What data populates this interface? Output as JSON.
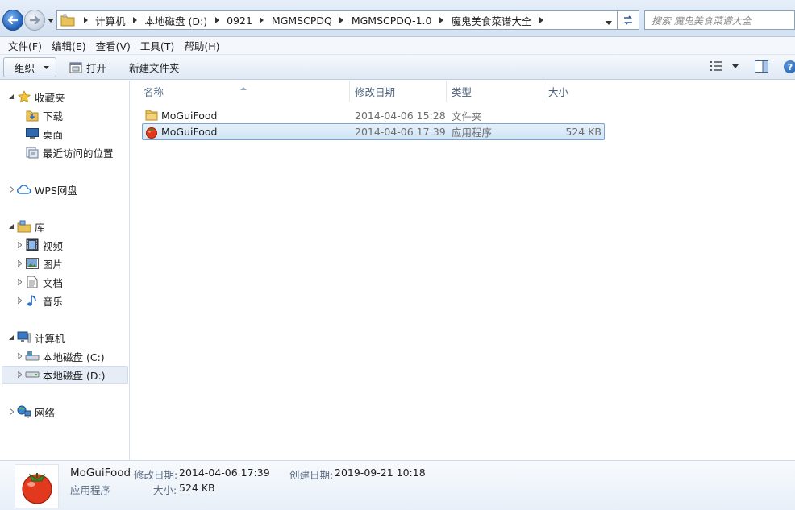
{
  "address_bar": {
    "crumbs": [
      "计算机",
      "本地磁盘 (D:)",
      "0921",
      "MGMSCPDQ",
      "MGMSCPDQ-1.0",
      "魔鬼美食菜谱大全"
    ],
    "search_placeholder": "搜索 魔鬼美食菜谱大全"
  },
  "menu": {
    "file": "文件(F)",
    "edit": "编辑(E)",
    "view": "查看(V)",
    "tools": "工具(T)",
    "help": "帮助(H)"
  },
  "toolbar": {
    "organize": "组织",
    "open": "打开",
    "new_folder": "新建文件夹",
    "help": "?"
  },
  "nav": {
    "favorites": "收藏夹",
    "downloads": "下载",
    "desktop": "桌面",
    "recent": "最近访问的位置",
    "wps": "WPS网盘",
    "libraries": "库",
    "videos": "视频",
    "pictures": "图片",
    "documents": "文档",
    "music": "音乐",
    "computer": "计算机",
    "drive_c": "本地磁盘 (C:)",
    "drive_d": "本地磁盘 (D:)",
    "network": "网络"
  },
  "columns": {
    "name": "名称",
    "modified": "修改日期",
    "type": "类型",
    "size": "大小"
  },
  "files": [
    {
      "name": "MoGuiFood",
      "modified": "2014-04-06 15:28",
      "type": "文件夹",
      "size": "",
      "icon": "folder-icon"
    },
    {
      "name": "MoGuiFood",
      "modified": "2014-04-06 17:39",
      "type": "应用程序",
      "size": "524 KB",
      "icon": "tomato-icon"
    }
  ],
  "details": {
    "name": "MoGuiFood",
    "type": "应用程序",
    "modified_label": "修改日期:",
    "modified_value": "2014-04-06 17:39",
    "size_label": "大小:",
    "size_value": "524 KB",
    "created_label": "创建日期:",
    "created_value": "2019-09-21 10:18"
  }
}
